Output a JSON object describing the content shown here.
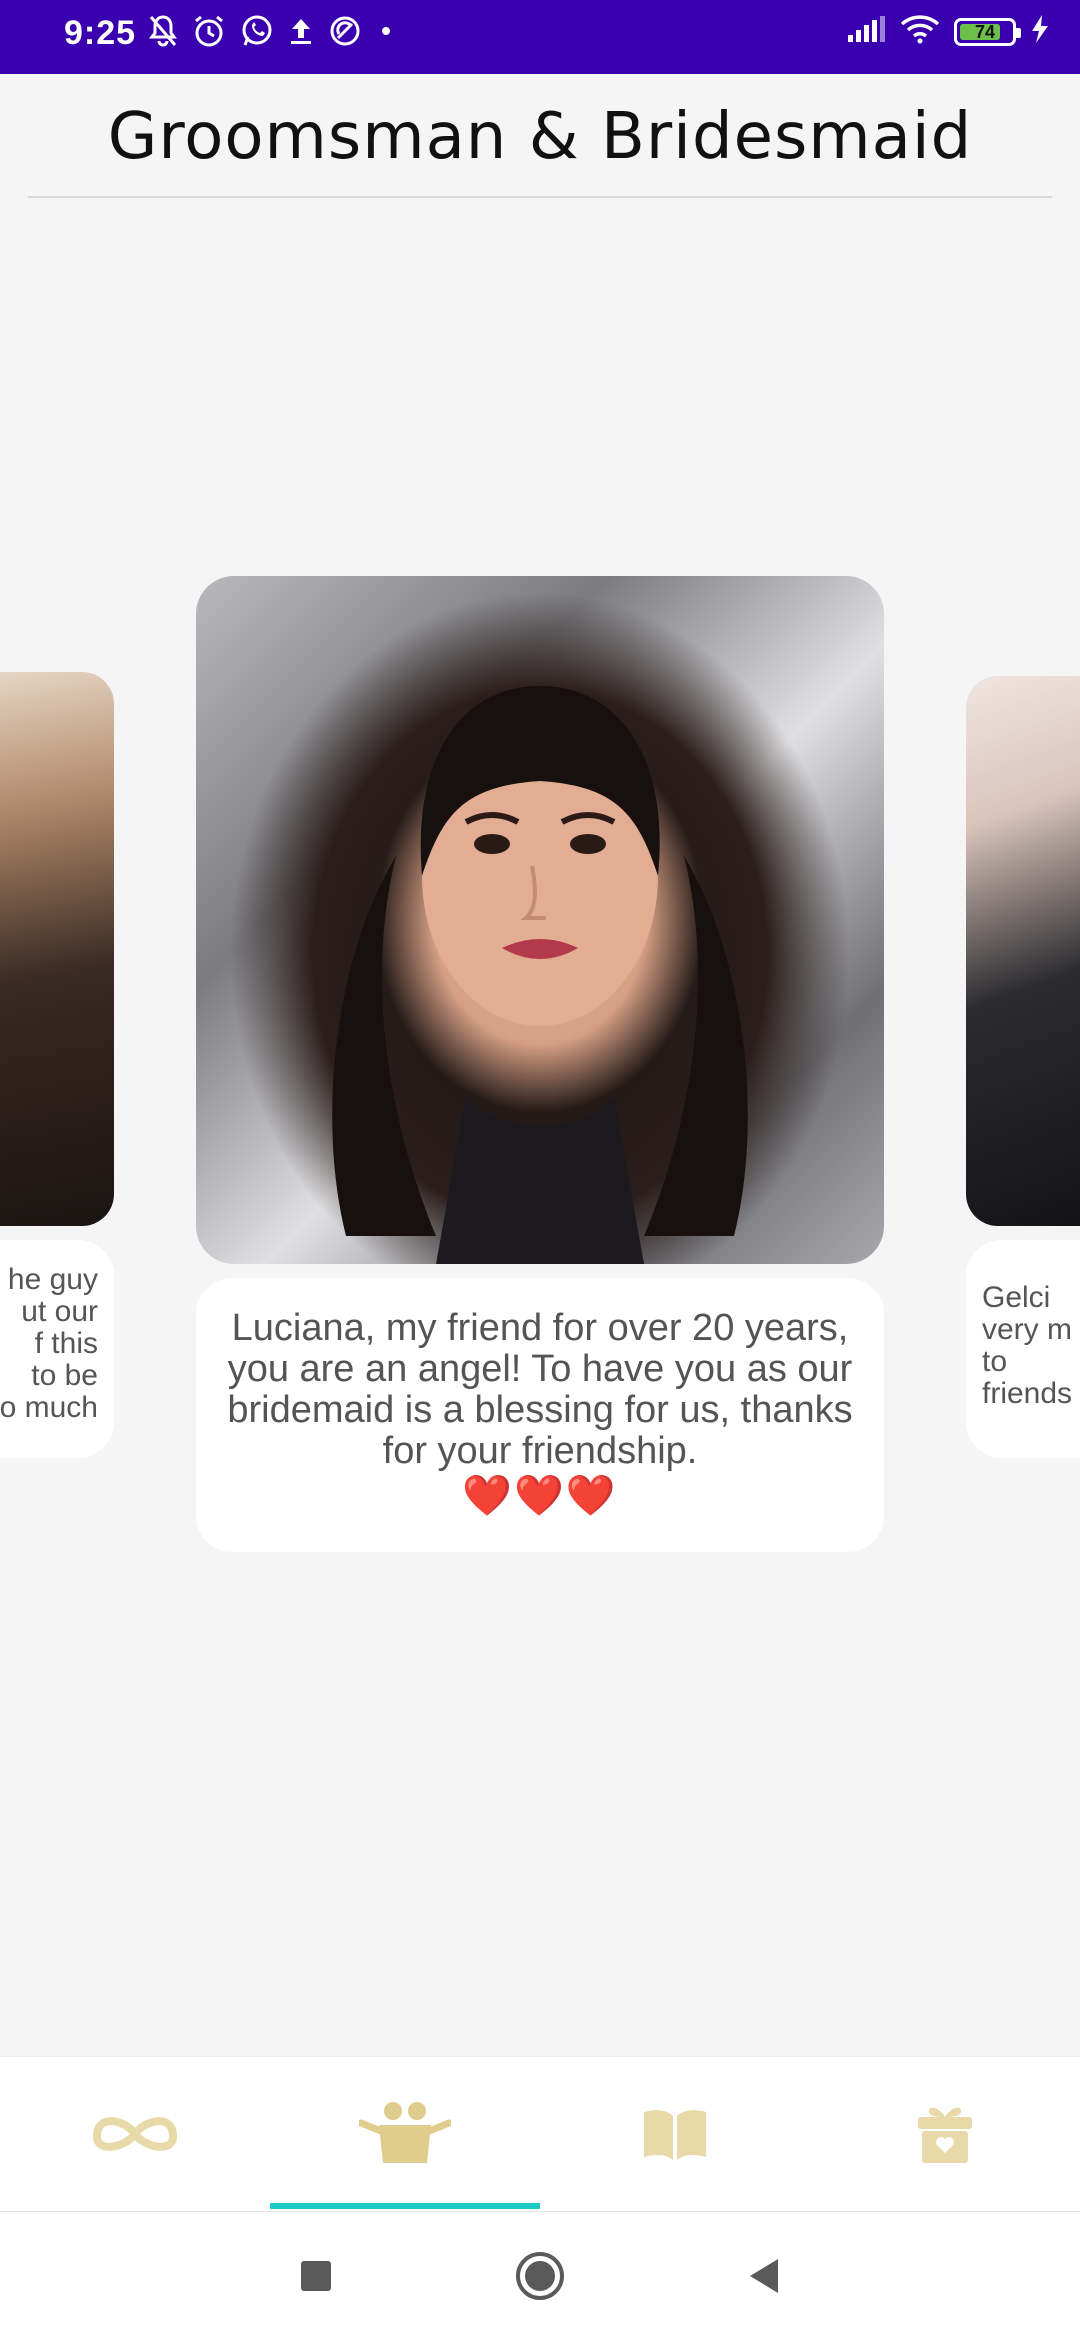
{
  "status_bar": {
    "time": "9:25",
    "battery_level": "74",
    "left_icons": [
      "muted-bell-icon",
      "alarm-icon",
      "whatsapp-icon",
      "upload-icon",
      "sync-icon",
      "dot-icon"
    ],
    "right_icons": [
      "signal-icon",
      "wifi-icon",
      "battery-icon",
      "charging-icon"
    ]
  },
  "header": {
    "title": "Groomsman & Bridesmaid"
  },
  "carousel": {
    "center": {
      "caption": "Luciana, my friend for over 20 years, you are an angel! To have you as our bridemaid is a blessing for us, thanks for your friendship.",
      "hearts": "❤️❤️❤️"
    },
    "left": {
      "caption_lines": [
        "he guy",
        "ut our",
        "f this",
        "to be",
        "o much"
      ]
    },
    "right": {
      "caption_lines": [
        "Gelci",
        "very m",
        "to",
        "friends"
      ]
    }
  },
  "bottom_nav": {
    "items": [
      {
        "icon": "infinity-icon",
        "active": false
      },
      {
        "icon": "couple-icon",
        "active": true
      },
      {
        "icon": "book-icon",
        "active": false
      },
      {
        "icon": "gift-box-icon",
        "active": false
      }
    ],
    "icon_color": "#e8d9a8",
    "active_icon_color": "#e0cc8c",
    "indicator_color": "#1fc9c9"
  },
  "colors": {
    "status_bar": "#3a00b0",
    "background": "#f5f5f5",
    "heart": "#d8141f"
  }
}
